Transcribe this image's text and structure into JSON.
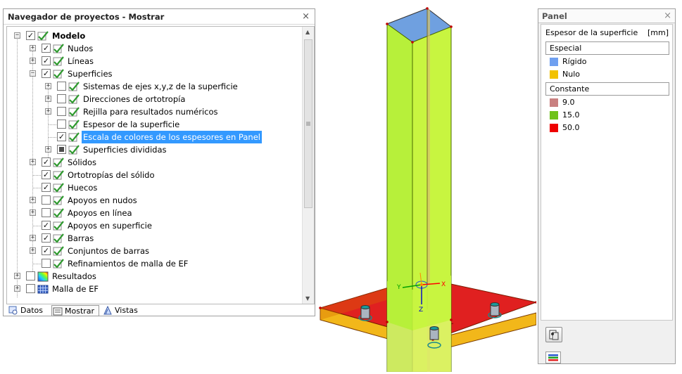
{
  "navigator": {
    "title": "Navegador de proyectos - Mostrar",
    "close": "×",
    "tree": [
      {
        "label": "Modelo",
        "bold": true
      },
      {
        "label": "Nudos"
      },
      {
        "label": "Líneas"
      },
      {
        "label": "Superficies"
      },
      {
        "label": "Sistemas de ejes x,y,z de la superficie"
      },
      {
        "label": "Direcciones de ortotropía"
      },
      {
        "label": "Rejilla para resultados numéricos"
      },
      {
        "label": "Espesor de la superficie"
      },
      {
        "label": "Escala de colores de los espesores en Panel",
        "selected": true
      },
      {
        "label": "Superficies divididas"
      },
      {
        "label": "Sólidos"
      },
      {
        "label": "Ortotropías del sólido"
      },
      {
        "label": "Huecos"
      },
      {
        "label": "Apoyos en nudos"
      },
      {
        "label": "Apoyos en línea"
      },
      {
        "label": "Apoyos en superficie"
      },
      {
        "label": "Barras"
      },
      {
        "label": "Conjuntos de barras"
      },
      {
        "label": "Refinamientos de malla de EF"
      },
      {
        "label": "Resultados"
      },
      {
        "label": "Malla de EF"
      }
    ],
    "tabs": [
      {
        "label": "Datos"
      },
      {
        "label": "Mostrar"
      },
      {
        "label": "Vistas"
      }
    ]
  },
  "viewport": {
    "axis_x": "X",
    "axis_y": "Y",
    "axis_z": "Z"
  },
  "panel": {
    "title": "Panel",
    "close": "×",
    "heading": "Espesor de la superficie",
    "unit": "[mm]",
    "groups": {
      "special": "Especial",
      "constant": "Constante"
    },
    "special_items": [
      {
        "label": "Rígido",
        "color": "#6fa0f0"
      },
      {
        "label": "Nulo",
        "color": "#f2c200"
      }
    ],
    "constant_items": [
      {
        "label": "9.0",
        "color": "#c98080"
      },
      {
        "label": "15.0",
        "color": "#6fc21b"
      },
      {
        "label": "50.0",
        "color": "#ee0000"
      }
    ]
  }
}
